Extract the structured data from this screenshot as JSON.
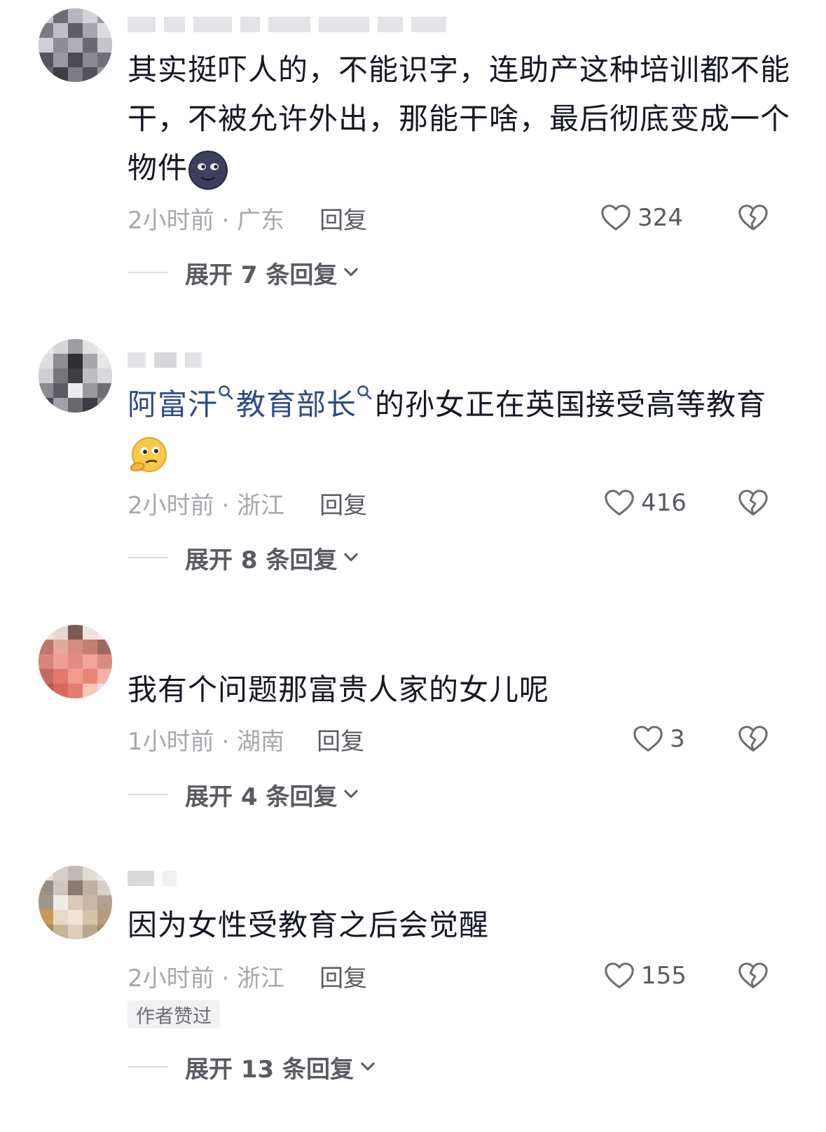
{
  "comments": [
    {
      "text": "其实挺吓人的，不能识字，连助产这种培训都不能干，不被允许外出，那能干啥，最后彻底变成一个物件",
      "time_location": "2小时前 · 广东",
      "reply_label": "回复",
      "likes": "324",
      "expand_label": "展开 7 条回复",
      "emoji": "new-moon-face-emoji"
    },
    {
      "text_link_1": "阿富汗",
      "text_link_2": "教育部长",
      "text": "的孙女正在英国接受高等教育",
      "time_location": "2小时前 · 浙江",
      "reply_label": "回复",
      "likes": "416",
      "expand_label": "展开 8 条回复",
      "emoji": "thinking-face-emoji"
    },
    {
      "text": "我有个问题那富贵人家的女儿呢",
      "time_location": "1小时前 · 湖南",
      "reply_label": "回复",
      "likes": "3",
      "expand_label": "展开 4 条回复"
    },
    {
      "text": "因为女性受教育之后会觉醒",
      "time_location": "2小时前 · 浙江",
      "reply_label": "回复",
      "likes": "155",
      "author_badge": "作者赞过",
      "expand_label": "展开 13 条回复"
    }
  ],
  "icons": {
    "like": "heart-outline-icon",
    "dislike": "broken-heart-icon",
    "expand": "chevron-down-icon",
    "search": "search-icon"
  },
  "colors": {
    "text": "#161823",
    "link": "#2b4b86",
    "meta": "#a7a8ad",
    "action": "#5a5b62"
  }
}
